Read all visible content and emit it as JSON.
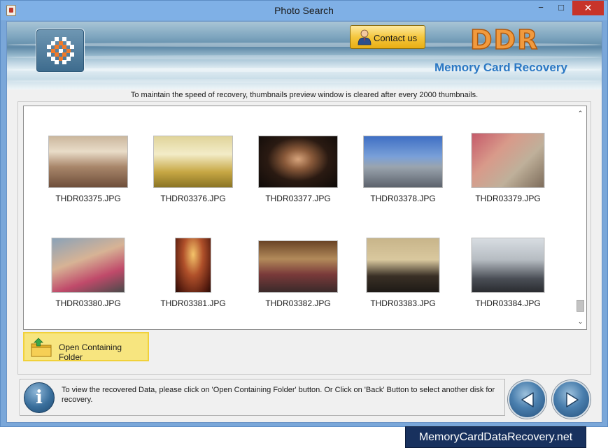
{
  "window": {
    "title": "Photo Search",
    "minimize_glyph": "−",
    "maximize_glyph": "□",
    "close_glyph": "✕"
  },
  "header": {
    "contact_label": "Contact us",
    "brand": "DDR",
    "product": "Memory Card Recovery"
  },
  "notice": "To maintain the speed of recovery, thumbnails preview window is cleared after every 2000 thumbnails.",
  "thumbnails": [
    {
      "label": "THDR03375.JPG",
      "icon": "photo-interior-icon"
    },
    {
      "label": "THDR03376.JPG",
      "icon": "photo-hall-icon"
    },
    {
      "label": "THDR03377.JPG",
      "icon": "photo-portrait-icon"
    },
    {
      "label": "THDR03378.JPG",
      "icon": "photo-city-icon"
    },
    {
      "label": "THDR03379.JPG",
      "icon": "photo-street-icon"
    },
    {
      "label": "THDR03380.JPG",
      "icon": "photo-people-icon"
    },
    {
      "label": "THDR03381.JPG",
      "icon": "photo-ballroom-icon"
    },
    {
      "label": "THDR03382.JPG",
      "icon": "photo-dance-icon"
    },
    {
      "label": "THDR03383.JPG",
      "icon": "photo-group-icon"
    },
    {
      "label": "THDR03384.JPG",
      "icon": "photo-office-icon"
    }
  ],
  "scroll": {
    "up_glyph": "⌃",
    "down_glyph": "⌄"
  },
  "open_folder_label": "Open Containing Folder",
  "info": {
    "icon_glyph": "i",
    "text": "To view the recovered Data, please click on 'Open Containing Folder' button. Or Click on 'Back' Button to select another disk for recovery."
  },
  "site_banner": "MemoryCardDataRecovery.net",
  "colors": {
    "accent": "#2b78c4",
    "brand": "#f19a3e",
    "highlight": "#f7e57f"
  }
}
